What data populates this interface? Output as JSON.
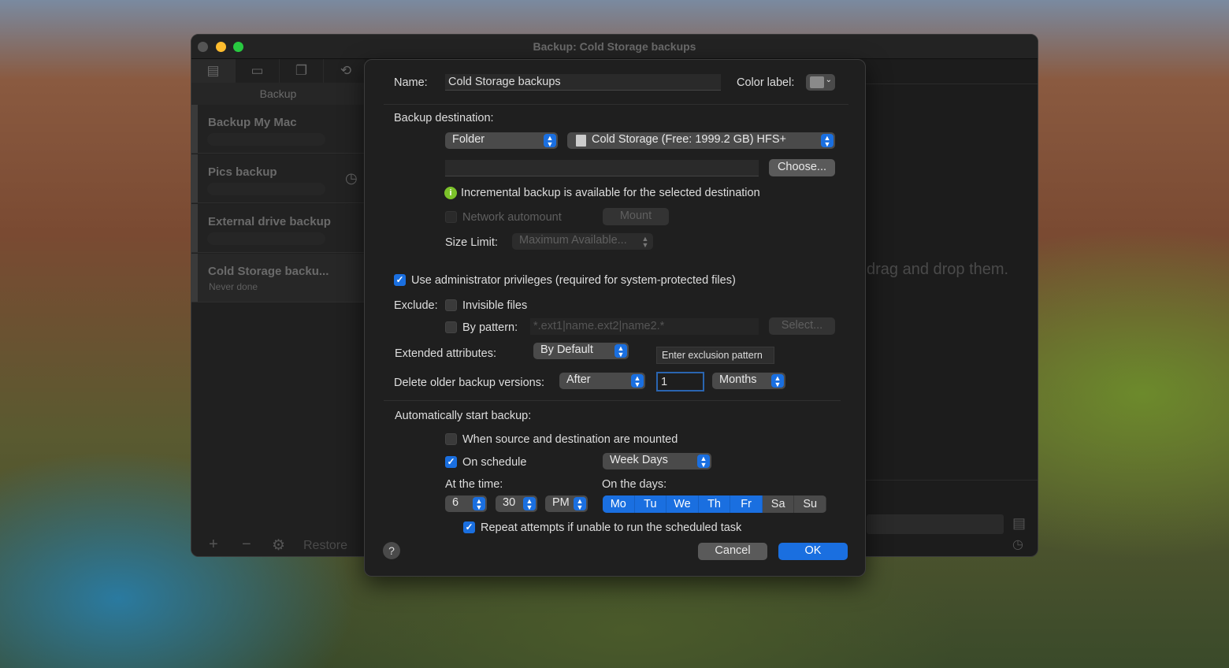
{
  "window": {
    "title": "Backup: Cold Storage backups",
    "drop_hint": "drag and drop them."
  },
  "sidebar": {
    "tab_label": "Backup",
    "toolbar_icons": [
      "backup-icon",
      "archive-icon",
      "copy-icon",
      "sync-icon"
    ],
    "items": [
      {
        "name": "Backup My Mac",
        "status": ""
      },
      {
        "name": "Pics backup",
        "status": "",
        "scheduled": true
      },
      {
        "name": "External drive backup",
        "status": ""
      },
      {
        "name": "Cold Storage backu...",
        "status": "Never done",
        "selected": true
      }
    ],
    "bottom": {
      "add": "+",
      "remove": "−",
      "restore": "Restore"
    }
  },
  "dialog": {
    "name_label": "Name:",
    "name_value": "Cold Storage backups",
    "color_label": "Color label:",
    "color_value": "#8a8a8a",
    "dest_label": "Backup destination:",
    "dest_type": "Folder",
    "dest_volume": "Cold Storage (Free: 1999.2 GB) HFS+",
    "path_value": "",
    "choose": "Choose...",
    "incremental_info": "Incremental backup is available for the selected destination",
    "network_automount": "Network automount",
    "mount": "Mount",
    "size_limit_label": "Size Limit:",
    "size_limit_value": "Maximum Available...",
    "admin_privileges": "Use administrator privileges (required for system-protected files)",
    "admin_checked": true,
    "exclude_label": "Exclude:",
    "invisible_files": "Invisible files",
    "invisible_checked": false,
    "by_pattern": "By pattern:",
    "by_pattern_checked": false,
    "pattern_placeholder": "*.ext1|name.ext2|name2.*",
    "select": "Select...",
    "ext_attr_label": "Extended attributes:",
    "ext_attr_value": "By Default",
    "tooltip": "Enter exclusion pattern",
    "delete_label": "Delete older backup versions:",
    "delete_mode": "After",
    "delete_count": "1",
    "delete_unit": "Months",
    "auto_label": "Automatically start backup:",
    "when_mounted": "When source and destination are mounted",
    "when_mounted_checked": false,
    "on_schedule": "On schedule",
    "on_schedule_checked": true,
    "schedule_value": "Week Days",
    "at_time_label": "At the time:",
    "hour": "6",
    "minute": "30",
    "ampm": "PM",
    "on_days_label": "On the days:",
    "days": [
      {
        "d": "Mo",
        "on": true
      },
      {
        "d": "Tu",
        "on": true
      },
      {
        "d": "We",
        "on": true
      },
      {
        "d": "Th",
        "on": true
      },
      {
        "d": "Fr",
        "on": true
      },
      {
        "d": "Sa",
        "on": false
      },
      {
        "d": "Su",
        "on": false
      }
    ],
    "repeat": "Repeat attempts if unable to run the scheduled task",
    "repeat_checked": true,
    "help": "?",
    "cancel": "Cancel",
    "ok": "OK"
  },
  "colors": {
    "accent": "#1a6fe0",
    "info": "#7cc22a"
  }
}
